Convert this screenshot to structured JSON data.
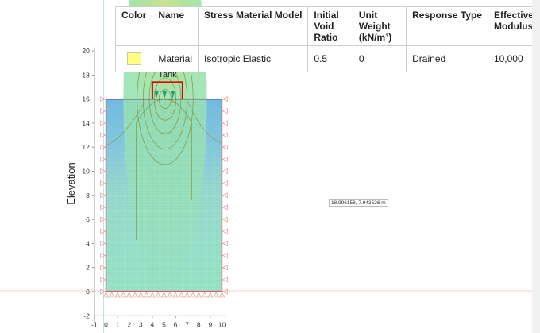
{
  "table": {
    "headers": [
      "Color",
      "Name",
      "Stress Material Model",
      "Initial Void Ratio",
      "Unit Weight (kN/m³)",
      "Response Type",
      "Effective Modulus"
    ],
    "rows": [
      {
        "color": "#ffff80",
        "name": "Material",
        "model": "Isotropic Elastic",
        "void_ratio": "0.5",
        "unit_weight": "0",
        "response": "Drained",
        "modulus": "10,000"
      }
    ]
  },
  "plot": {
    "ylabel": "Elevation",
    "tank_label": "Tank",
    "x_ticks": [
      "-1",
      "0",
      "1",
      "2",
      "3",
      "4",
      "5",
      "6",
      "7",
      "8",
      "9",
      "10"
    ],
    "y_ticks": [
      "-2",
      "0",
      "2",
      "4",
      "6",
      "8",
      "10",
      "12",
      "14",
      "16",
      "18",
      "20"
    ],
    "coord_readout": "18.996158, 7.943526 m",
    "colors": {
      "boundary": "#d62020",
      "mesh": "#9bd8c9",
      "contour": "#7a9a4a",
      "tank": "#e00000",
      "load_arrow": "#1aa07a"
    }
  }
}
